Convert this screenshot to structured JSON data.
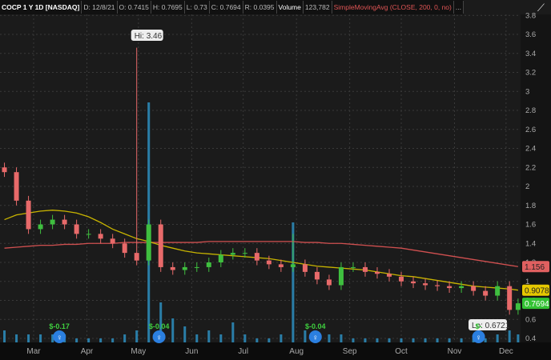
{
  "header": {
    "symbol": "COCP 1 Y 1D [NASDAQ]",
    "date": "D: 12/8/21",
    "open": "O: 0.7415",
    "high": "H: 0.7695",
    "low": "L: 0.73",
    "close": "C: 0.7694",
    "range": "R: 0.0395",
    "volume_label": "Volume",
    "volume_value": "123,782",
    "study": "SimpleMovingAvg (CLOSE, 200, 0, no)",
    "more": "..."
  },
  "colors": {
    "up": "#3fbf3f",
    "down": "#e86a6a",
    "sma_fast": "#c8b400",
    "sma_slow": "#d05050",
    "volume": "#2a7ea8",
    "background": "#1b1b1b"
  },
  "chart_data": {
    "type": "candlestick",
    "ylim": [
      0.4,
      3.8
    ],
    "yticks": [
      "3.8",
      "3.6",
      "3.4",
      "3.2",
      "3",
      "2.8",
      "2.6",
      "2.4",
      "2.2",
      "2",
      "1.8",
      "1.6",
      "1.4",
      "1.2",
      "1",
      "0.8",
      "0.6",
      "0.4"
    ],
    "xticks": [
      {
        "label": "Mar",
        "date": "2021-03-01"
      },
      {
        "label": "Apr",
        "date": "2021-04-01"
      },
      {
        "label": "May",
        "date": "2021-05-01"
      },
      {
        "label": "Jun",
        "date": "2021-06-01"
      },
      {
        "label": "Jul",
        "date": "2021-07-01"
      },
      {
        "label": "Aug",
        "date": "2021-08-01"
      },
      {
        "label": "Sep",
        "date": "2021-09-01"
      },
      {
        "label": "Oct",
        "date": "2021-10-01"
      },
      {
        "label": "Nov",
        "date": "2021-11-01"
      },
      {
        "label": "Dec",
        "date": "2021-12-01"
      }
    ],
    "dates": [
      "2021-02-12",
      "2021-02-19",
      "2021-02-26",
      "2021-03-05",
      "2021-03-12",
      "2021-03-19",
      "2021-03-26",
      "2021-04-02",
      "2021-04-09",
      "2021-04-16",
      "2021-04-23",
      "2021-04-30",
      "2021-05-07",
      "2021-05-14",
      "2021-05-21",
      "2021-05-28",
      "2021-06-04",
      "2021-06-11",
      "2021-06-18",
      "2021-06-25",
      "2021-07-02",
      "2021-07-09",
      "2021-07-16",
      "2021-07-23",
      "2021-07-30",
      "2021-08-06",
      "2021-08-13",
      "2021-08-20",
      "2021-08-27",
      "2021-09-03",
      "2021-09-10",
      "2021-09-17",
      "2021-09-24",
      "2021-10-01",
      "2021-10-08",
      "2021-10-15",
      "2021-10-22",
      "2021-10-29",
      "2021-11-05",
      "2021-11-12",
      "2021-11-19",
      "2021-11-26",
      "2021-12-03",
      "2021-12-08"
    ],
    "close": [
      2.15,
      1.85,
      1.55,
      1.6,
      1.65,
      1.6,
      1.5,
      1.5,
      1.45,
      1.4,
      1.3,
      1.22,
      1.6,
      1.15,
      1.12,
      1.15,
      1.15,
      1.2,
      1.28,
      1.3,
      1.3,
      1.22,
      1.18,
      1.15,
      1.18,
      1.1,
      1.02,
      0.96,
      1.15,
      1.15,
      1.1,
      1.08,
      1.05,
      1.0,
      0.98,
      0.96,
      0.95,
      0.93,
      0.95,
      0.9,
      0.85,
      0.95,
      0.7,
      0.7694
    ],
    "spike_highs": {
      "2021-04-30": 3.46,
      "2021-07-30": 1.5
    },
    "volume": [
      3,
      2,
      2,
      2,
      2,
      2,
      1,
      1,
      1,
      1,
      2,
      3,
      60,
      10,
      6,
      4,
      2,
      3,
      2,
      5,
      2,
      1,
      1,
      2,
      30,
      3,
      2,
      2,
      2,
      1,
      1,
      1,
      1,
      1,
      1,
      1,
      1,
      1,
      1,
      1,
      1,
      2,
      3,
      2
    ],
    "sma_fast": [
      1.65,
      1.7,
      1.72,
      1.74,
      1.75,
      1.74,
      1.72,
      1.68,
      1.62,
      1.55,
      1.5,
      1.45,
      1.42,
      1.38,
      1.35,
      1.32,
      1.3,
      1.29,
      1.28,
      1.27,
      1.26,
      1.25,
      1.24,
      1.22,
      1.2,
      1.18,
      1.16,
      1.15,
      1.14,
      1.13,
      1.12,
      1.1,
      1.08,
      1.06,
      1.05,
      1.03,
      1.01,
      0.99,
      0.97,
      0.95,
      0.94,
      0.93,
      0.92,
      0.9078
    ],
    "sma_slow": [
      1.35,
      1.36,
      1.37,
      1.38,
      1.38,
      1.39,
      1.39,
      1.4,
      1.4,
      1.4,
      1.41,
      1.41,
      1.41,
      1.41,
      1.41,
      1.41,
      1.41,
      1.42,
      1.42,
      1.42,
      1.42,
      1.42,
      1.42,
      1.42,
      1.42,
      1.41,
      1.41,
      1.4,
      1.4,
      1.39,
      1.38,
      1.37,
      1.36,
      1.35,
      1.33,
      1.31,
      1.29,
      1.27,
      1.25,
      1.23,
      1.21,
      1.19,
      1.17,
      1.156
    ],
    "annotations": {
      "high": "Hi: 3.46",
      "low": "Lo: 0.6721",
      "last_close": "0.7694",
      "sma_fast_value": "0.9078",
      "sma_slow_value": "1.156"
    },
    "earnings": [
      {
        "date": "2021-03-16",
        "label": "$-0.17"
      },
      {
        "date": "2021-05-13",
        "label": "$-0.04"
      },
      {
        "date": "2021-08-12",
        "label": "$-0.04"
      },
      {
        "date": "2021-11-15",
        "label": "$-"
      }
    ]
  }
}
